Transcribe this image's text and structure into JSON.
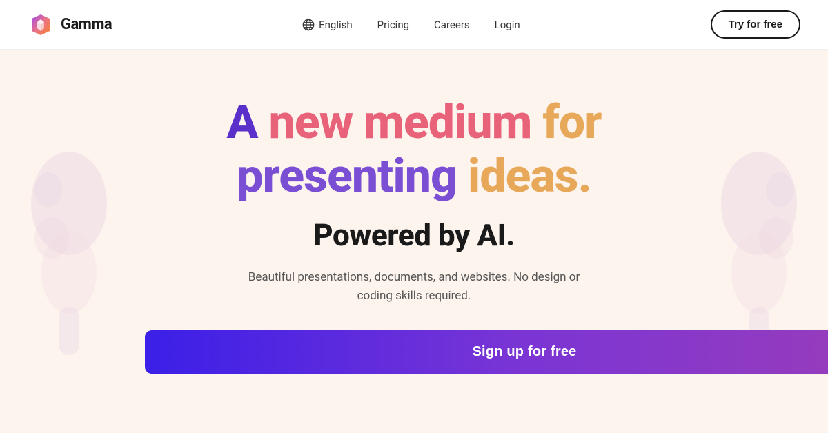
{
  "navbar": {
    "logo_text": "Gamma",
    "lang_label": "English",
    "nav_items": [
      {
        "label": "Pricing",
        "id": "pricing"
      },
      {
        "label": "Careers",
        "id": "careers"
      },
      {
        "label": "Login",
        "id": "login"
      }
    ],
    "try_free_label": "Try for free"
  },
  "hero": {
    "headline_line1_part1": "A ",
    "headline_line1_word1": "new",
    "headline_line1_part2": " medium for",
    "headline_line2_word1": "presenting",
    "headline_line2_part2": " ideas.",
    "powered_line": "Powered by AI.",
    "subtext": "Beautiful presentations, documents, and websites. No design or\ncoding skills required.",
    "cta_label": "Sign up for free"
  }
}
